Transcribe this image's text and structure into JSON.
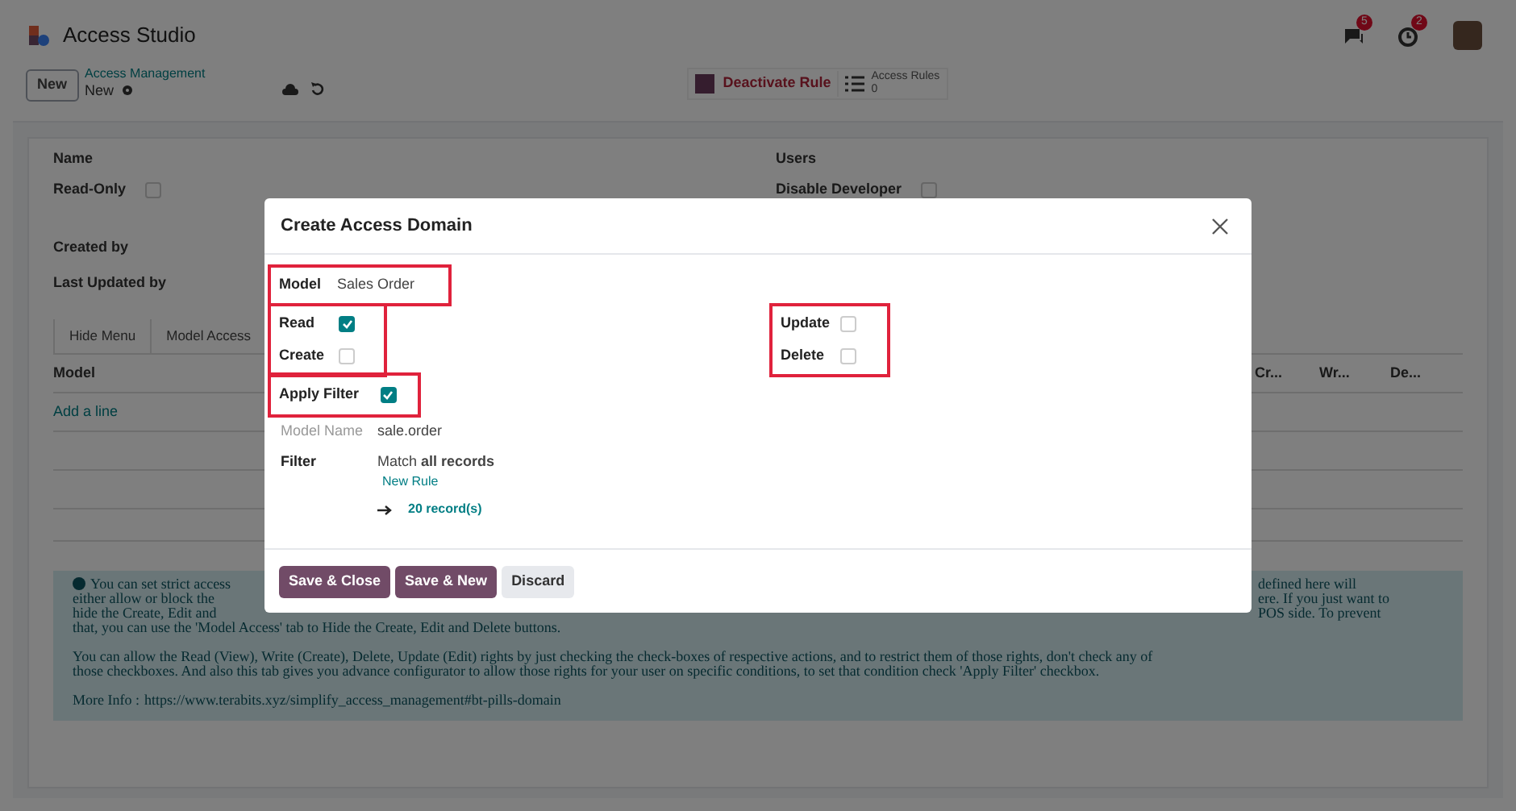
{
  "app": {
    "title": "Access Studio",
    "messages_badge": "5",
    "activities_badge": "2"
  },
  "control_bar": {
    "new_button": "New",
    "breadcrumb": "Access Management",
    "record": "New",
    "action": "Deactivate Rule",
    "smart_button": {
      "label": "Access Rules",
      "count": "0"
    }
  },
  "form": {
    "left_fields": [
      {
        "label": "Name",
        "kind": "text"
      },
      {
        "label": "Read-Only",
        "kind": "checkbox",
        "checked": false
      },
      {
        "label": "Created by",
        "kind": "text"
      },
      {
        "label": "Last Updated by",
        "kind": "text"
      }
    ],
    "right_fields": [
      {
        "label": "Users",
        "kind": "text"
      },
      {
        "label": "Disable Developer",
        "kind": "checkbox",
        "checked": false
      }
    ],
    "tabs": [
      {
        "label": "Hide Menu",
        "selected": false
      },
      {
        "label": "Model Access",
        "selected": false
      }
    ],
    "table": {
      "columns": [
        "Model",
        "Cr...",
        "Wr...",
        "De..."
      ],
      "add_line": "Add a line"
    },
    "info": {
      "lines": [
        {
          "left": "You can set strict access",
          "right": "defined here will"
        },
        {
          "left": "either allow or block the",
          "right": "ere. If you just want to"
        },
        {
          "left": "hide the Create, Edit and",
          "right": "POS side. To prevent"
        },
        {
          "left": "that, you can use the 'Model Access' tab to Hide the Create, Edit and Delete buttons."
        }
      ],
      "paragraph": [
        "You can allow the Read (View), Write (Create), Delete, Update (Edit) rights by just checking the check-boxes of respective actions, and to restrict them of those rights, don't check any of",
        "those checkboxes. And also this tab gives you advance configurator to allow those rights for your user on specific conditions, to set that condition check 'Apply Filter' checkbox."
      ],
      "more_label": "More Info :",
      "more_link": "https://www.terabits.xyz/simplify_access_management#bt-pills-domain"
    }
  },
  "dialog": {
    "title": "Create Access Domain",
    "model": {
      "label": "Model",
      "value": "Sales Order",
      "highlighted": true
    },
    "left_checks": {
      "highlighted": true,
      "items": [
        {
          "label": "Read",
          "checked": true
        },
        {
          "label": "Create",
          "checked": false
        }
      ]
    },
    "right_checks": {
      "highlighted": true,
      "items": [
        {
          "label": "Update",
          "checked": false
        },
        {
          "label": "Delete",
          "checked": false
        }
      ]
    },
    "apply_filter": {
      "label": "Apply Filter",
      "checked": true,
      "highlighted": true
    },
    "model_name": {
      "label": "Model Name",
      "value": "sale.order"
    },
    "filter": {
      "label": "Filter",
      "match": "Match **all records**",
      "new_rule": "New Rule",
      "records": "20 record(s)"
    },
    "buttons": [
      {
        "label": "Save & Close",
        "kind": "primary"
      },
      {
        "label": "Save & New",
        "kind": "primary"
      },
      {
        "label": "Discard",
        "kind": "secondary"
      }
    ]
  }
}
